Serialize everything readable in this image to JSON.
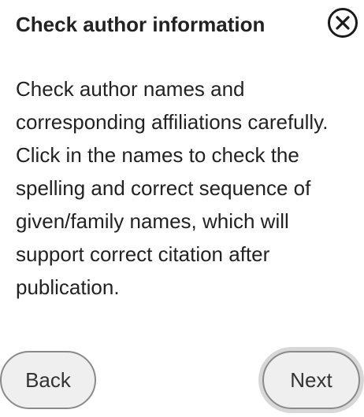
{
  "dialog": {
    "title": "Check author information",
    "close_icon": "close-icon",
    "body_text": "Check author names and corresponding affiliations carefully. Click in the names to check the spelling and correct sequence of given/family names, which will support correct citation after publication.",
    "back_label": "Back",
    "next_label": "Next"
  }
}
